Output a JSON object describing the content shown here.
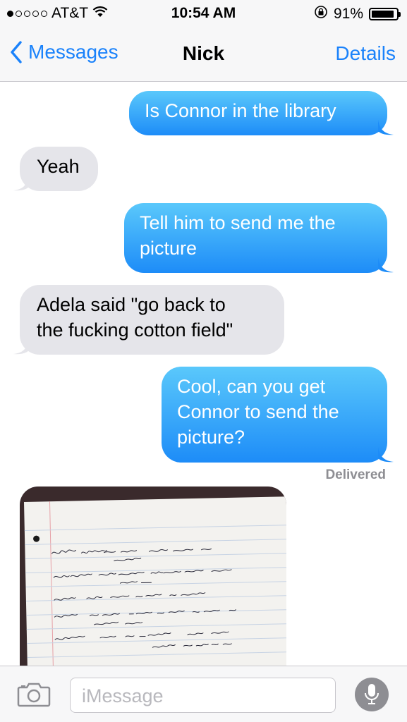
{
  "status_bar": {
    "carrier": "AT&T",
    "signal_dots_filled": 1,
    "signal_dots_total": 5,
    "time": "10:54 AM",
    "battery": "91%",
    "battery_level": 0.91
  },
  "nav": {
    "back_label": "Messages",
    "title": "Nick",
    "details_label": "Details"
  },
  "messages": [
    {
      "direction": "outgoing",
      "text": "Is Connor in the library"
    },
    {
      "direction": "incoming",
      "text": "Yeah"
    },
    {
      "direction": "outgoing",
      "text_lines": [
        "Tell him to send me the",
        "picture"
      ]
    },
    {
      "direction": "incoming",
      "text_lines": [
        "Adela said \"go back to",
        "the fucking cotton field\""
      ]
    },
    {
      "direction": "outgoing",
      "text_lines": [
        "Cool, can you get",
        "Connor to send the",
        "picture?"
      ]
    },
    {
      "direction": "incoming",
      "type": "image"
    }
  ],
  "delivered_label": "Delivered",
  "input": {
    "placeholder": "iMessage"
  },
  "icons": {
    "back": "chevron-left-icon",
    "camera": "camera-icon",
    "mic": "microphone-icon",
    "wifi": "wifi-icon",
    "lock": "rotation-lock-icon"
  },
  "colors": {
    "accent": "#1a82fb",
    "outgoing_top": "#5ac8fb",
    "outgoing_bottom": "#1d8cf8",
    "incoming": "#e5e5ea"
  }
}
